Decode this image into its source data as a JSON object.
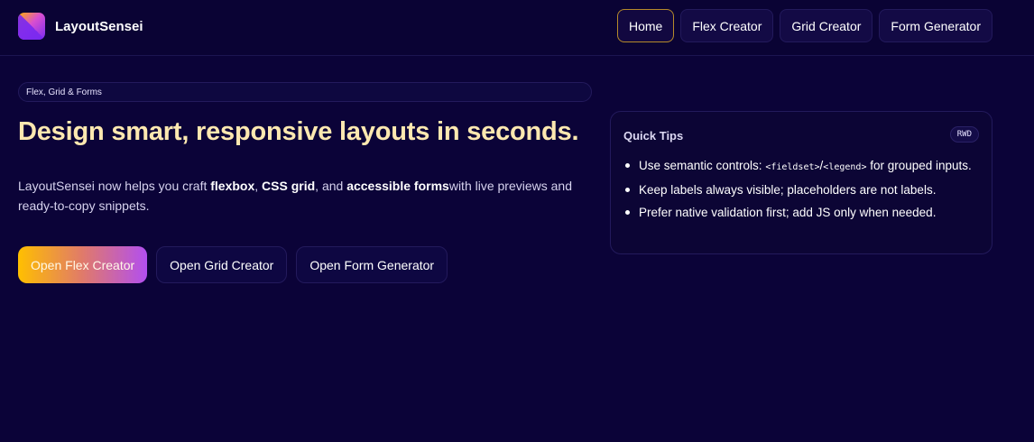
{
  "brand": {
    "name": "LayoutSensei",
    "logo_icon": "gradient-square-logo"
  },
  "nav": [
    {
      "label": "Home",
      "active": true
    },
    {
      "label": "Flex Creator",
      "active": false
    },
    {
      "label": "Grid Creator",
      "active": false
    },
    {
      "label": "Form Generator",
      "active": false
    }
  ],
  "hero": {
    "badge": "Flex, Grid & Forms",
    "headline": "Design smart, responsive layouts in seconds.",
    "lead": {
      "p1": "LayoutSensei now helps you craft ",
      "b1": "flexbox",
      "p2": ", ",
      "b2": "CSS grid",
      "p3": ", and ",
      "b3": "accessible forms",
      "p4": "with live previews and ready-to-copy snippets."
    },
    "cta": {
      "flex": "Open Flex Creator",
      "grid": "Open Grid Creator",
      "form": "Open Form Generator"
    }
  },
  "tips": {
    "title": "Quick Tips",
    "tag": "RWD",
    "t1_pre": "Use semantic controls: ",
    "t1_code1": "<fieldset>",
    "t1_sep": "/",
    "t1_code2": "<legend>",
    "t1_post": " for grouped inputs.",
    "t2": "Keep labels always visible; placeholders are not labels.",
    "t3": "Prefer native validation first; add JS only when needed."
  },
  "colors": {
    "background": "#0b0338",
    "headline": "#fde8b0",
    "accent_gradient_start": "#ffbf00",
    "accent_gradient_end": "#b24ff0",
    "active_nav_border": "#b58a2a"
  }
}
